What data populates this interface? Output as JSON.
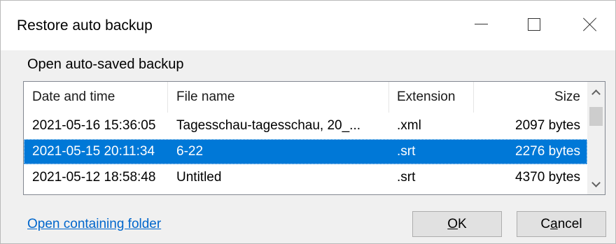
{
  "window": {
    "title": "Restore auto backup"
  },
  "group_label": "Open auto-saved backup",
  "columns": {
    "date": "Date and time",
    "name": "File name",
    "ext": "Extension",
    "size": "Size"
  },
  "rows": [
    {
      "date": "2021-05-16 15:36:05",
      "name": "Tagesschau-tagesschau, 20_...",
      "ext": ".xml",
      "size": "2097 bytes",
      "selected": false
    },
    {
      "date": "2021-05-15 20:11:34",
      "name": "6-22",
      "ext": ".srt",
      "size": "2276 bytes",
      "selected": true
    },
    {
      "date": "2021-05-12 18:58:48",
      "name": "Untitled",
      "ext": ".srt",
      "size": "4370 bytes",
      "selected": false
    }
  ],
  "footer": {
    "link": "Open containing folder",
    "ok_mnemonic": "O",
    "ok_rest": "K",
    "cancel_pre": "C",
    "cancel_mnemonic": "a",
    "cancel_rest": "ncel"
  },
  "colors": {
    "selection": "#0078d7",
    "link": "#0066cc"
  },
  "icons": [
    "minimize-icon",
    "maximize-icon",
    "close-icon",
    "scroll-up-icon",
    "scroll-down-icon"
  ]
}
